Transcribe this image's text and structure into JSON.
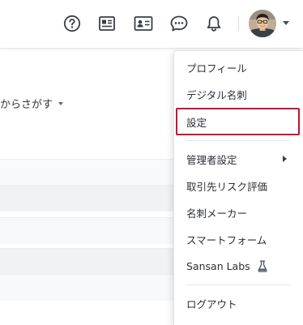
{
  "header": {
    "icons": [
      {
        "name": "help-icon"
      },
      {
        "name": "business-card-list-icon"
      },
      {
        "name": "contact-card-icon"
      },
      {
        "name": "chat-icon"
      },
      {
        "name": "notification-bell-icon"
      }
    ],
    "avatar_caret": "chevron-down-icon"
  },
  "background": {
    "search_label": "からさがす"
  },
  "menu": {
    "items": [
      {
        "label": "プロフィール"
      },
      {
        "label": "デジタル名刺"
      },
      {
        "label": "設定",
        "highlighted": true
      },
      {
        "label": "管理者設定",
        "has_submenu": true
      },
      {
        "label": "取引先リスク評価"
      },
      {
        "label": "名刺メーカー"
      },
      {
        "label": "スマートフォーム"
      },
      {
        "label": "Sansan Labs",
        "icon": "flask-icon"
      },
      {
        "label": "ログアウト"
      }
    ]
  },
  "colors": {
    "highlight_border": "#c8102e",
    "icon": "#3a3f47",
    "row_alt": "#f1f2f4"
  }
}
